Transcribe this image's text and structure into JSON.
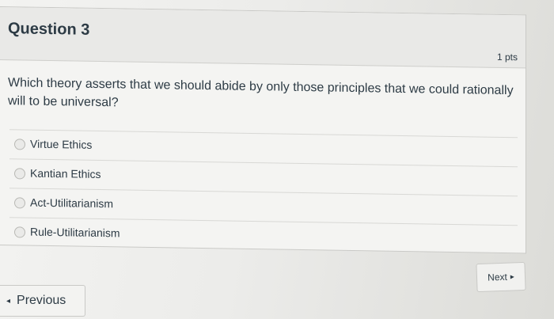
{
  "question": {
    "title": "Question 3",
    "points": "1 pts",
    "text": "Which theory asserts that we should abide by only those principles that we could rationally will to be universal?"
  },
  "answers": [
    {
      "label": "Virtue Ethics"
    },
    {
      "label": "Kantian Ethics"
    },
    {
      "label": "Act-Utilitarianism"
    },
    {
      "label": "Rule-Utilitarianism"
    }
  ],
  "navigation": {
    "next_label": "Next",
    "previous_label": "Previous"
  }
}
